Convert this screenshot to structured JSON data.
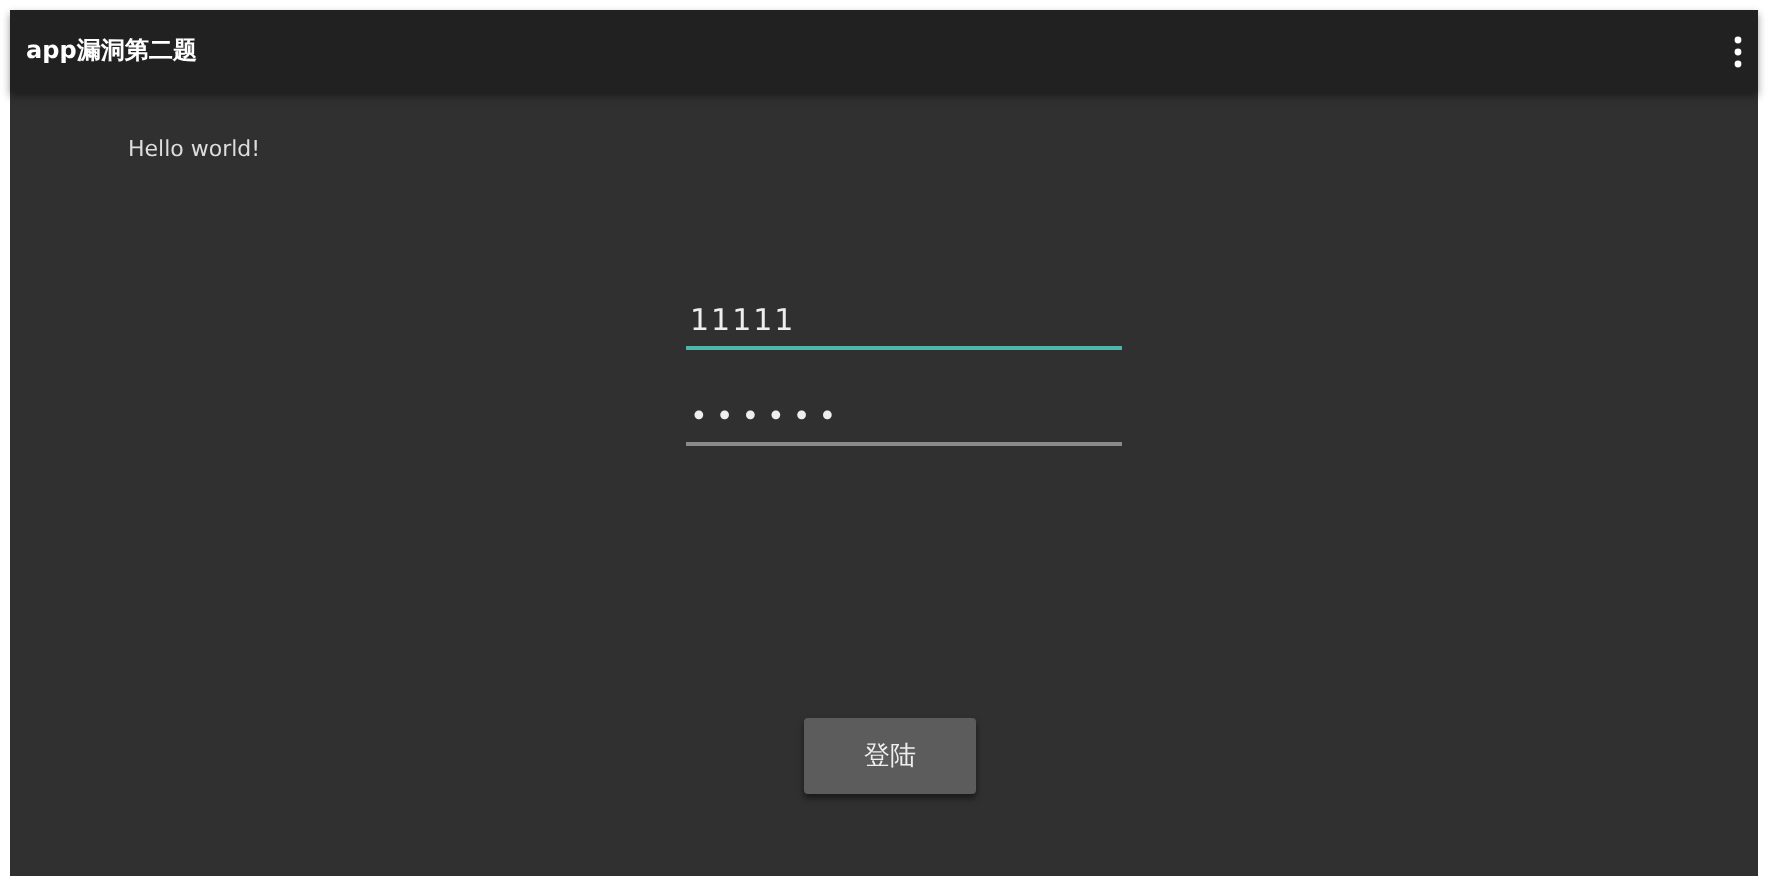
{
  "app_bar": {
    "title": "app漏洞第二题"
  },
  "greeting": "Hello world!",
  "fields": [
    {
      "kind": "text",
      "value": "11111",
      "focused": true
    },
    {
      "kind": "password",
      "value": "••••••",
      "focused": false
    }
  ],
  "button": {
    "label": "登陆"
  }
}
